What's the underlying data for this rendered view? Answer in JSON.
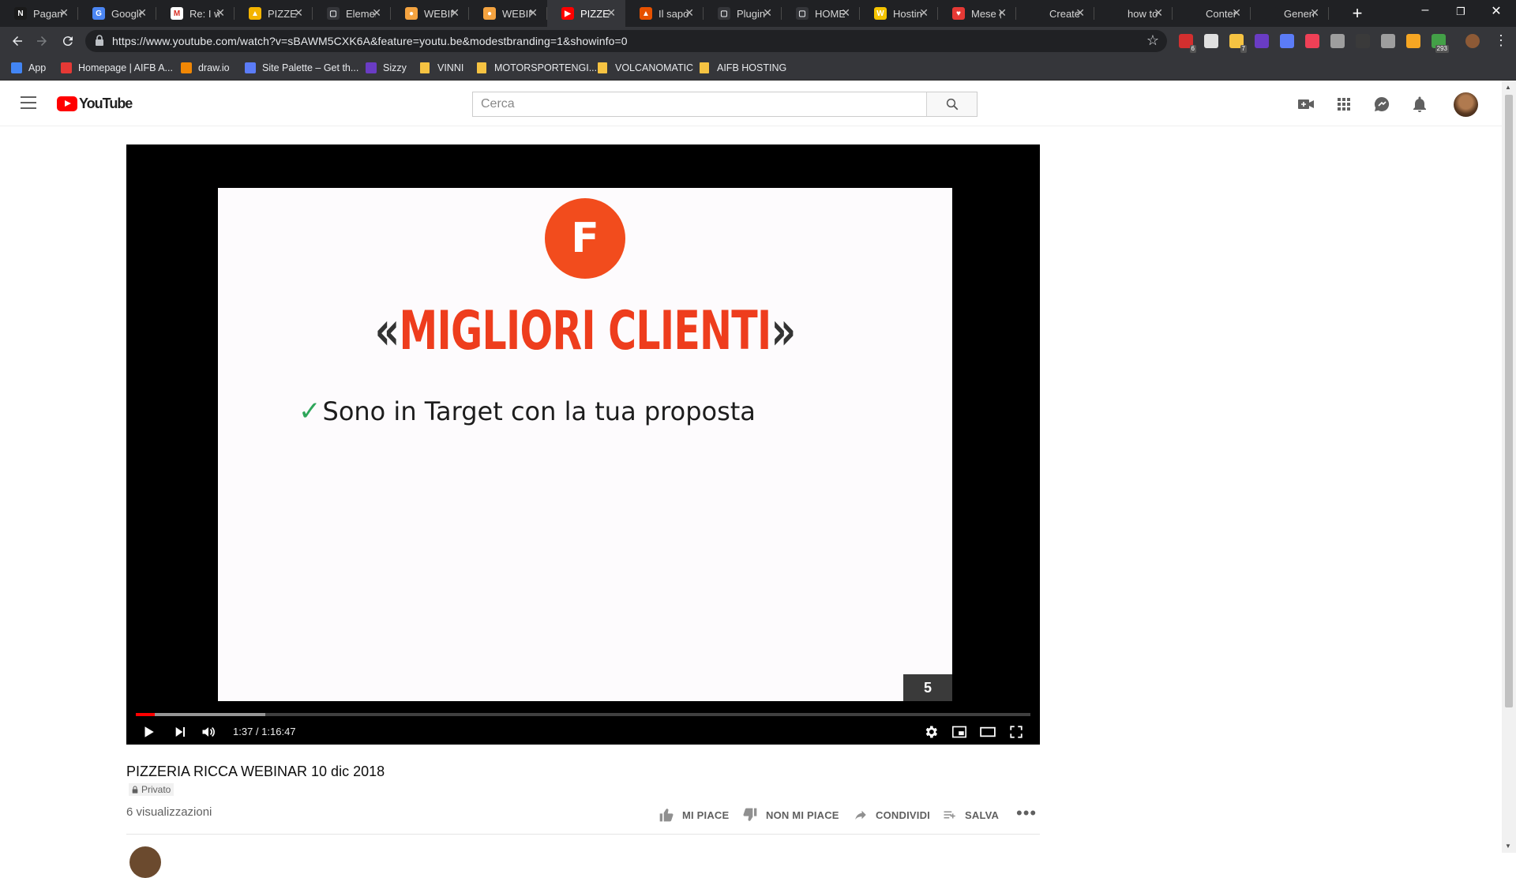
{
  "browser": {
    "tabs": [
      {
        "title": "Pagam",
        "favicon_color": "#1a1a1a",
        "favicon_glyph": "N",
        "active": false
      },
      {
        "title": "Google",
        "favicon_color": "#4b86f3",
        "favicon_glyph": "G",
        "active": false
      },
      {
        "title": "Re: I w",
        "favicon_color": "#ffffff",
        "favicon_glyph": "M",
        "active": false
      },
      {
        "title": "PIZZER",
        "favicon_color": "#f4b400",
        "favicon_glyph": "▲",
        "active": false
      },
      {
        "title": "Elemen",
        "favicon_color": "#35363a",
        "favicon_glyph": "▢",
        "active": false
      },
      {
        "title": "WEBIN",
        "favicon_color": "#f4a340",
        "favicon_glyph": "●",
        "active": false
      },
      {
        "title": "WEBIN",
        "favicon_color": "#f4a340",
        "favicon_glyph": "●",
        "active": false
      },
      {
        "title": "PIZZER",
        "favicon_color": "#ff0000",
        "favicon_glyph": "▶",
        "active": true
      },
      {
        "title": "Il sapo",
        "favicon_color": "#e65100",
        "favicon_glyph": "▲",
        "active": false
      },
      {
        "title": "Plugin",
        "favicon_color": "#35363a",
        "favicon_glyph": "▢",
        "active": false
      },
      {
        "title": "HOME",
        "favicon_color": "#35363a",
        "favicon_glyph": "▢",
        "active": false
      },
      {
        "title": "Hostin",
        "favicon_color": "#f5c400",
        "favicon_glyph": "W",
        "active": false
      },
      {
        "title": "Mese (",
        "favicon_color": "#e53935",
        "favicon_glyph": "♥",
        "active": false
      },
      {
        "title": "Create",
        "favicon_color": "#202124",
        "favicon_glyph": "",
        "active": false
      },
      {
        "title": "how to",
        "favicon_color": "#202124",
        "favicon_glyph": "",
        "active": false
      },
      {
        "title": "Conter",
        "favicon_color": "#202124",
        "favicon_glyph": "",
        "active": false
      },
      {
        "title": "Genera",
        "favicon_color": "#202124",
        "favicon_glyph": "",
        "active": false
      }
    ],
    "new_tab": "+",
    "window_controls": {
      "minimize": "–",
      "maximize": "❐",
      "close": "✕"
    },
    "url": "https://www.youtube.com/watch?v=sBAWM5CXK6A&feature=youtu.be&modestbranding=1&showinfo=0",
    "bookmarks": [
      {
        "label": "App",
        "icon": "apps-grid-icon",
        "color": "#4285f4"
      },
      {
        "label": "Homepage | AIFB A...",
        "icon": "site-icon",
        "color": "#e53935"
      },
      {
        "label": "draw.io",
        "icon": "drawio-icon",
        "color": "#f08705"
      },
      {
        "label": "Site Palette – Get th...",
        "icon": "palette-icon",
        "color": "#5b7cf7"
      },
      {
        "label": "Sizzy",
        "icon": "sizzy-icon",
        "color": "#6a3cc4"
      },
      {
        "label": "VINNI",
        "icon": "folder-icon",
        "color": "#f6c342"
      },
      {
        "label": "MOTORSPORTENGI...",
        "icon": "folder-icon",
        "color": "#f6c342"
      },
      {
        "label": "VOLCANOMATIC",
        "icon": "folder-icon",
        "color": "#f6c342"
      },
      {
        "label": "AIFB HOSTING",
        "icon": "folder-icon",
        "color": "#f6c342"
      }
    ],
    "extension_badges": [
      {
        "name": "adblock-icon",
        "color": "#d32f2f",
        "badge": "6"
      },
      {
        "name": "extension-icon",
        "color": "#e0e0e0",
        "badge": ""
      },
      {
        "name": "sticky-notes-icon",
        "color": "#f6c342",
        "badge": "7"
      },
      {
        "name": "sizzy-ext-icon",
        "color": "#6a3cc4",
        "badge": ""
      },
      {
        "name": "palette-ext-icon",
        "color": "#5b7cf7",
        "badge": ""
      },
      {
        "name": "pocket-icon",
        "color": "#ef4056",
        "badge": ""
      },
      {
        "name": "bulb-icon",
        "color": "#9e9e9e",
        "badge": ""
      },
      {
        "name": "dark-ext-icon",
        "color": "#3a3a3a",
        "badge": ""
      },
      {
        "name": "font-icon",
        "color": "#9e9e9e",
        "badge": ""
      },
      {
        "name": "text-cursor-icon",
        "color": "#f6a623",
        "badge": ""
      },
      {
        "name": "calendar-ext-icon",
        "color": "#43a047",
        "badge": "293"
      }
    ]
  },
  "youtube": {
    "logo_text": "YouTube",
    "search_placeholder": "Cerca",
    "video": {
      "slide_badge_letter": "F",
      "slide_headline_open": "«",
      "slide_headline_text": "MIGLIORI CLIENTI",
      "slide_headline_close": "»",
      "slide_point_check": "✓",
      "slide_point_text": "Sono in Target con la tua proposta",
      "slide_number": "5",
      "time_current": "1:37",
      "time_separator": " / ",
      "time_total": "1:16:47",
      "progress_played_fraction": 0.021,
      "progress_buffered_fraction": 0.145
    },
    "meta": {
      "title": "PIZZERIA RICCA WEBINAR 10 dic 2018",
      "privacy": "Privato",
      "views": "6 visualizzazioni",
      "like_label": "MI PIACE",
      "dislike_label": "NON MI PIACE",
      "share_label": "CONDIVIDI",
      "save_label": "SALVA",
      "more_label": "•••"
    },
    "colors": {
      "brand_red": "#ff0000",
      "headline_red": "#ee3d1d",
      "badge_orange": "#f24c1d",
      "check_green": "#2ea65a"
    }
  }
}
